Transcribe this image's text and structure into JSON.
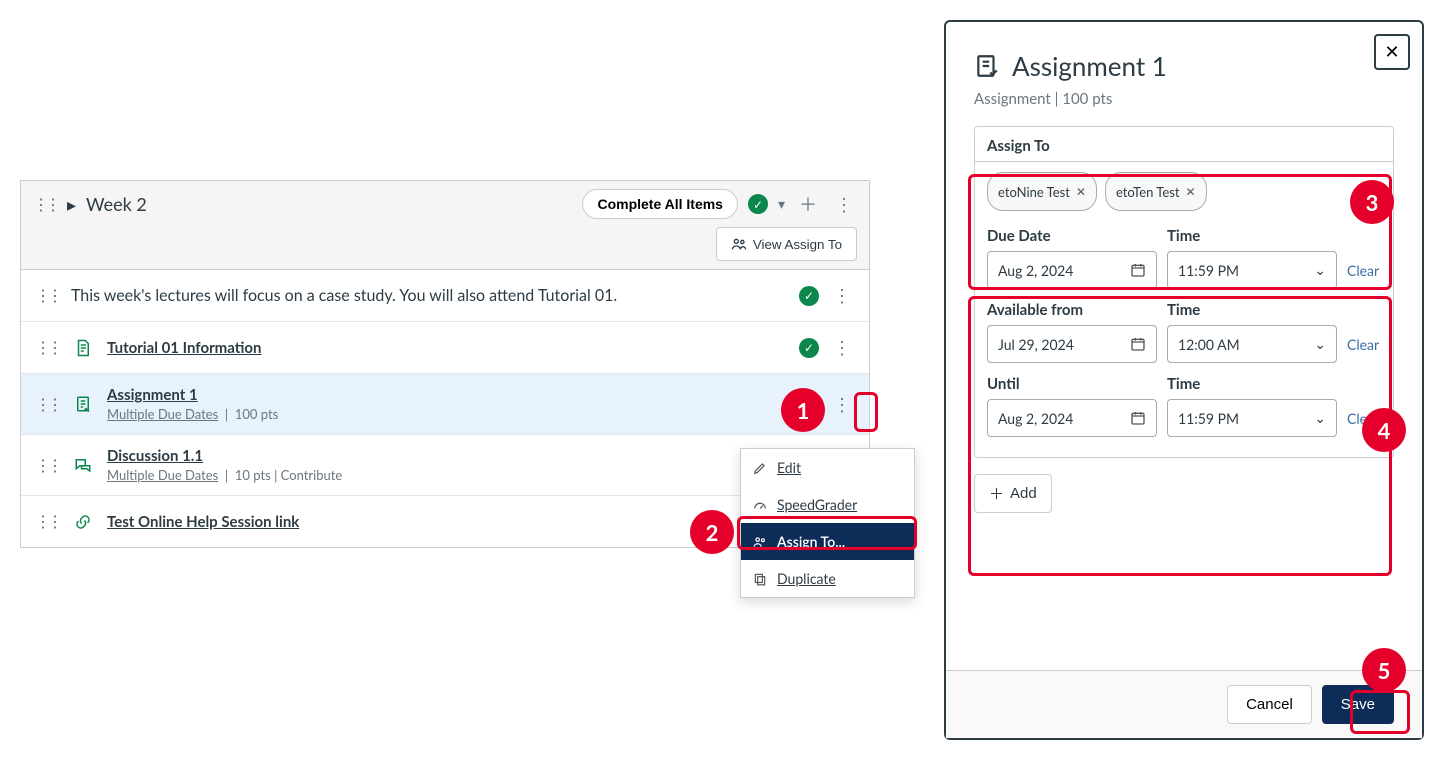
{
  "module": {
    "title": "Week 2",
    "complete_all_label": "Complete All Items",
    "view_assign_label": "View Assign To",
    "items": [
      {
        "type": "text",
        "title": "This week's lectures will focus on a case study. You will also attend Tutorial 01.",
        "meta": "",
        "published": true
      },
      {
        "type": "page",
        "title": "Tutorial 01 Information",
        "meta": "",
        "published": true
      },
      {
        "type": "assignment",
        "title": "Assignment 1",
        "meta_link": "Multiple Due Dates",
        "meta_rest": "100 pts"
      },
      {
        "type": "discussion",
        "title": "Discussion 1.1",
        "meta_link": "Multiple Due Dates",
        "meta_rest": "10 pts  |  Contribute"
      },
      {
        "type": "link",
        "title": "Test Online Help Session link",
        "meta": ""
      }
    ]
  },
  "menu": {
    "edit": "Edit",
    "speedgrader": "SpeedGrader",
    "assign_to": "Assign To...",
    "duplicate": "Duplicate"
  },
  "tray": {
    "title": "Assignment 1",
    "subtitle": "Assignment | 100 pts",
    "assign_to_label": "Assign To",
    "chips": [
      "etoNine Test",
      "etoTen Test"
    ],
    "due_date_label": "Due Date",
    "time_label": "Time",
    "available_from_label": "Available from",
    "until_label": "Until",
    "clear_label": "Clear",
    "add_label": "Add",
    "cancel_label": "Cancel",
    "save_label": "Save",
    "due_date": "Aug 2, 2024",
    "due_time": "11:59 PM",
    "from_date": "Jul 29, 2024",
    "from_time": "12:00 AM",
    "until_date": "Aug 2, 2024",
    "until_time": "11:59 PM"
  },
  "annotations": [
    "1",
    "2",
    "3",
    "4",
    "5"
  ]
}
